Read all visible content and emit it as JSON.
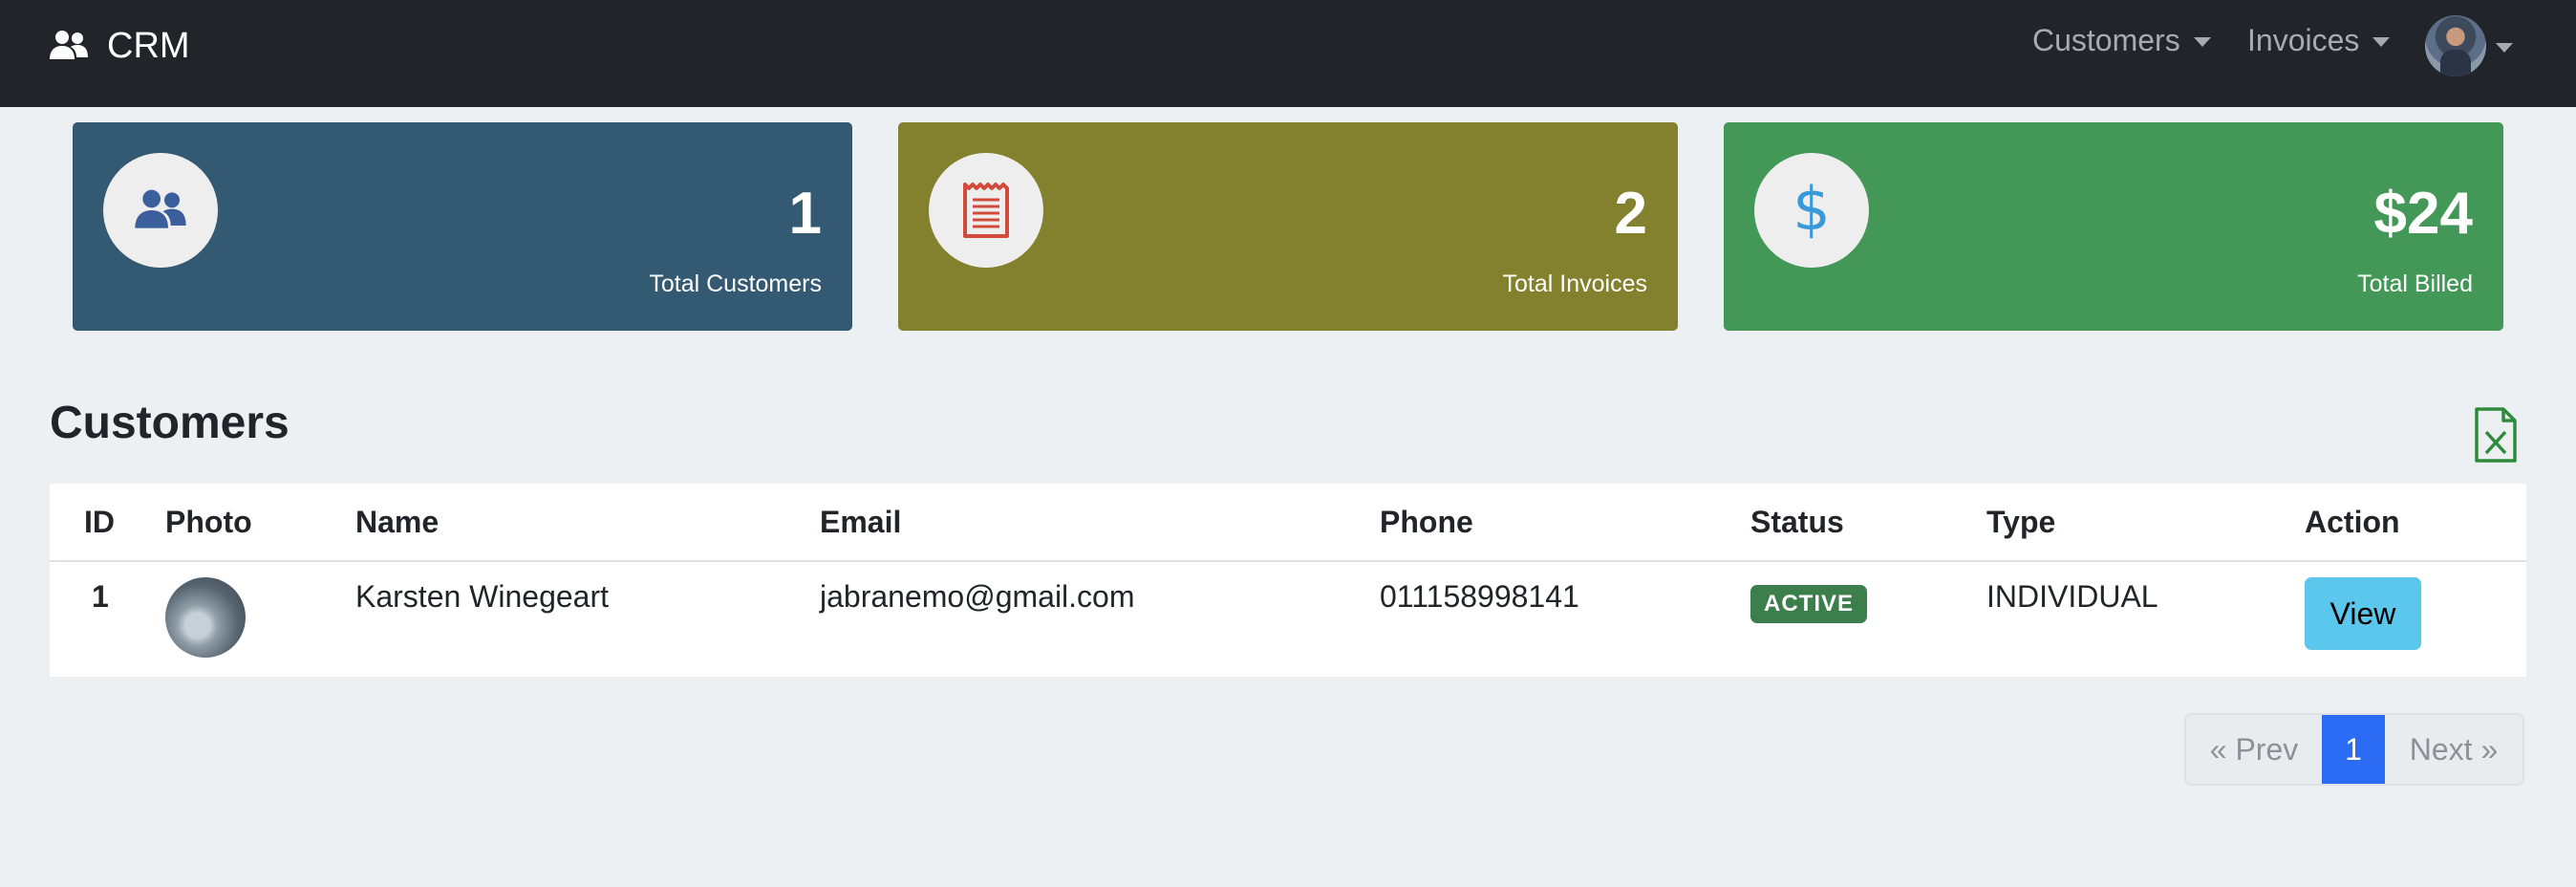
{
  "navbar": {
    "brand": "CRM",
    "brand_icon": "users-icon",
    "menu": [
      {
        "label": "Customers"
      },
      {
        "label": "Invoices"
      }
    ],
    "profile_icon": "user-avatar"
  },
  "stats": [
    {
      "value": "1",
      "label": "Total Customers",
      "icon": "users-icon",
      "color": "#345a73",
      "icon_color": "#3a5f9c"
    },
    {
      "value": "2",
      "label": "Total Invoices",
      "icon": "receipt-icon",
      "color": "#83812e",
      "icon_color": "#d24a3a"
    },
    {
      "value": "$24",
      "label": "Total Billed",
      "icon": "dollar-icon",
      "color": "#439757",
      "icon_color": "#3a9ad9"
    }
  ],
  "customers": {
    "title": "Customers",
    "export_icon": "excel-file-icon",
    "columns": [
      "ID",
      "Photo",
      "Name",
      "Email",
      "Phone",
      "Status",
      "Type",
      "Action"
    ],
    "rows": [
      {
        "id": "1",
        "name": "Karsten Winegeart",
        "email": "jabranemo@gmail.com",
        "phone": "011158998141",
        "status": "ACTIVE",
        "type": "INDIVIDUAL",
        "action": "View"
      }
    ]
  },
  "pagination": {
    "prev": "« Prev",
    "current": "1",
    "next": "Next »"
  },
  "colors": {
    "navbar": "#212529",
    "background": "#ecf0f3",
    "status_active": "#3d7f4c",
    "view_button": "#5bc7ec",
    "page_active": "#2c6cf5"
  }
}
